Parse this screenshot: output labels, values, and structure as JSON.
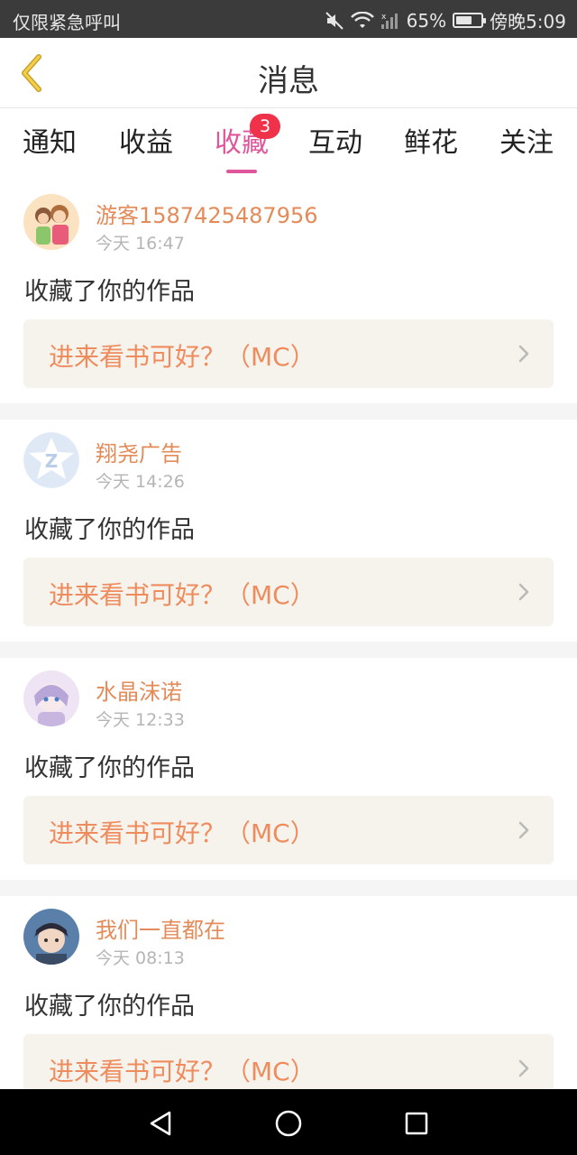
{
  "statusbar": {
    "carrier": "仅限紧急呼叫",
    "battery_percent": "65%",
    "battery_level": 0.65,
    "time": "傍晚5:09",
    "icons": [
      "mute-icon",
      "wifi-icon",
      "signal-icon",
      "battery-icon"
    ]
  },
  "header": {
    "title": "消息",
    "back_icon": "chevron-left-icon"
  },
  "tabs": [
    {
      "label": "通知",
      "active": false
    },
    {
      "label": "收益",
      "active": false
    },
    {
      "label": "收藏",
      "active": true,
      "badge": "3"
    },
    {
      "label": "互动",
      "active": false
    },
    {
      "label": "鲜花",
      "active": false
    },
    {
      "label": "关注",
      "active": false
    }
  ],
  "colors": {
    "accent": "#e0569a",
    "name": "#e38b59",
    "link": "#ef8c5e",
    "badge": "#f0314a"
  },
  "messages": [
    {
      "name": "游客1587425487956",
      "time": "今天 16:47",
      "action": "收藏了你的作品",
      "work": "进来看书可好？（MC）"
    },
    {
      "name": "翔尧广告",
      "time": "今天 14:26",
      "action": "收藏了你的作品",
      "work": "进来看书可好？（MC）"
    },
    {
      "name": "水晶沫诺",
      "time": "今天 12:33",
      "action": "收藏了你的作品",
      "work": "进来看书可好？（MC）"
    },
    {
      "name": "我们一直都在",
      "time": "今天 08:13",
      "action": "收藏了你的作品",
      "work": "进来看书可好？（MC）"
    }
  ],
  "navbar": {
    "icons": [
      "back-triangle-icon",
      "home-circle-icon",
      "recents-square-icon"
    ]
  }
}
